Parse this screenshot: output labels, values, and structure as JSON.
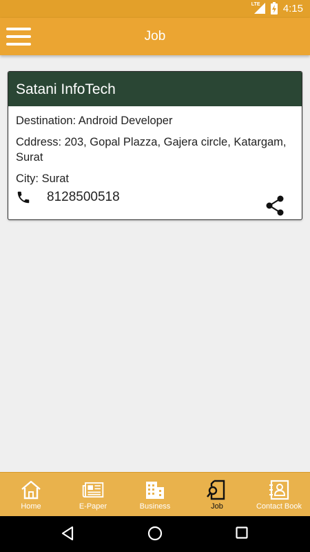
{
  "status_bar": {
    "network": "LTE",
    "time": "4:15"
  },
  "app_bar": {
    "title": "Job"
  },
  "job_card": {
    "company": "Satani InfoTech",
    "destination": "Destination: Android Developer",
    "address": "Cddress: 203, Gopal Plazza, Gajera circle, Katargam, Surat",
    "city": "City: Surat",
    "phone": "8128500518"
  },
  "bottom_nav": {
    "items": [
      {
        "label": "Home",
        "icon": "home-icon"
      },
      {
        "label": "E-Paper",
        "icon": "newspaper-icon"
      },
      {
        "label": "Business",
        "icon": "building-icon"
      },
      {
        "label": "Job",
        "icon": "job-search-icon",
        "active": true
      },
      {
        "label": "Contact Book",
        "icon": "contact-book-icon"
      }
    ]
  },
  "colors": {
    "status_bar": "#e3a02a",
    "app_bar": "#eba532",
    "card_header": "#2a4634",
    "bottom_nav": "#e9b24c",
    "background": "#efefef"
  }
}
